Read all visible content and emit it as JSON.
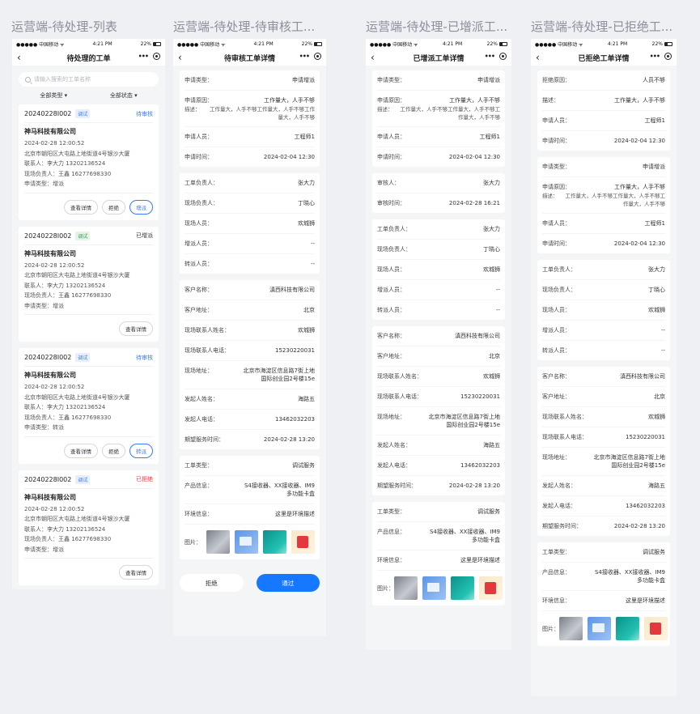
{
  "columns": {
    "list": "运营端-待处理-列表",
    "pending": "运营端-待处理-待审核工...",
    "added": "运营端-待处理-已增派工...",
    "rejected": "运营端-待处理-已拒绝工..."
  },
  "status_bar": {
    "carrier": "●●●●● 中国移动 ᯤ",
    "time": "4:21 PM",
    "battery": "22%"
  },
  "list_screen": {
    "nav_title": "待处理的工单",
    "search_placeholder": "请输入搜索的工单名称",
    "filter_type": "全部类型 ▾",
    "filter_status": "全部状态 ▾",
    "cards": [
      {
        "no": "20240228I002",
        "tag": "调试",
        "tag_color": "blue",
        "status": "待审核",
        "status_color": "#3a7bf0",
        "company": "神马科技有限公司",
        "time": "2024-02-28 12:00:52",
        "addr": "北京市朝阳区大屯路上地街道4号银沙大厦",
        "contact": "联系人：李大力  13202136524",
        "leader": "现场负责人：王鑫  16277698330",
        "apply": "申请类型：增派",
        "actions": [
          "查看详情",
          "拒绝",
          "增派"
        ]
      },
      {
        "no": "20240228I002",
        "tag": "调试",
        "tag_color": "green",
        "status": "已增派",
        "status_color": "#333333",
        "company": "神马科技有限公司",
        "time": "2024-02-28 12:00:52",
        "addr": "北京市朝阳区大屯路上地街道4号银沙大厦",
        "contact": "联系人：李大力  13202136524",
        "leader": "现场负责人：王鑫  16277698330",
        "apply": "申请类型：增派",
        "actions": [
          "查看详情"
        ]
      },
      {
        "no": "20240228I002",
        "tag": "调试",
        "tag_color": "blue",
        "status": "待审核",
        "status_color": "#3a7bf0",
        "company": "神马科技有限公司",
        "time": "2024-02-28 12:00:52",
        "addr": "北京市朝阳区大屯路上地街道4号银沙大厦",
        "contact": "联系人：李大力  13202136524",
        "leader": "现场负责人：王鑫  16277698330",
        "apply": "申请类型：转派",
        "actions": [
          "查看详情",
          "拒绝",
          "转派"
        ]
      },
      {
        "no": "20240228I002",
        "tag": "调试",
        "tag_color": "blue",
        "status": "已拒绝",
        "status_color": "#e4393c",
        "company": "神马科技有限公司",
        "time": "2024-02-28 12:00:52",
        "addr": "北京市朝阳区大屯路上地街道4号银沙大厦",
        "contact": "联系人：李大力  13202136524",
        "leader": "现场负责人：王鑫  16277698330",
        "apply": "申请类型：增派",
        "actions": [
          "查看详情"
        ]
      }
    ]
  },
  "pending_screen": {
    "nav_title": "待审核工单详情",
    "apply": {
      "type_k": "申请类型：",
      "type_v": "申请增派",
      "reason_k": "申请原因：",
      "reason_v": "工作量大，人手不够",
      "desc_k": "描述：",
      "desc_v": "工作量大，人手不够工作量大，人手不够工作量大，人手不够",
      "applicant_k": "申请人员：",
      "applicant_v": "工程师1",
      "time_k": "申请时间：",
      "time_v": "2024-02-04 12:30"
    },
    "staff": [
      [
        "工单负责人：",
        "张大力"
      ],
      [
        "现场负责人：",
        "丁晓心"
      ],
      [
        "现场人员：",
        "欢城狮"
      ],
      [
        "增派人员：",
        "--"
      ],
      [
        "转派人员：",
        "--"
      ]
    ],
    "customer": [
      [
        "客户名称：",
        "滇西科技有限公司"
      ],
      [
        "客户地址：",
        "北京"
      ],
      [
        "现场联系人姓名：",
        "欢城狮"
      ],
      [
        "现场联系人电话：",
        "15230220031"
      ],
      [
        "现场地址：",
        "北京市海淀区信息路7街上地国际创业园2号楼15e"
      ],
      [
        "发起人姓名：",
        "海路五"
      ],
      [
        "发起人电话：",
        "13462032203"
      ],
      [
        "期望服务时间：",
        "2024-02-28 13:20"
      ]
    ],
    "order": [
      [
        "工单类型：",
        "调试服务"
      ],
      [
        "产品信息：",
        "S4接收器、XX接收器、IM9多功能卡盒"
      ],
      [
        "环境信息：",
        "这里是环境描述"
      ]
    ],
    "images_k": "图片：",
    "reject_btn": "拒绝",
    "pass_btn": "通过"
  },
  "added_screen": {
    "nav_title": "已增派工单详情",
    "apply": {
      "type_k": "申请类型：",
      "type_v": "申请增派",
      "reason_k": "申请原因：",
      "reason_v": "工作量大，人手不够",
      "desc_k": "描述：",
      "desc_v": "工作量大，人手不够工作量大，人手不够工作量大，人手不够",
      "applicant_k": "申请人员：",
      "applicant_v": "工程师1",
      "time_k": "申请时间：",
      "time_v": "2024-02-04 12:30"
    },
    "review": [
      [
        "审核人：",
        "张大力"
      ],
      [
        "审核时间：",
        "2024-02-28 16:21"
      ]
    ],
    "staff": [
      [
        "工单负责人：",
        "张大力"
      ],
      [
        "现场负责人：",
        "丁晓心"
      ],
      [
        "现场人员：",
        "欢城狮"
      ],
      [
        "增派人员：",
        "--"
      ],
      [
        "转派人员：",
        "--"
      ]
    ],
    "customer": [
      [
        "客户名称：",
        "滇西科技有限公司"
      ],
      [
        "客户地址：",
        "北京"
      ],
      [
        "现场联系人姓名：",
        "欢城狮"
      ],
      [
        "现场联系人电话：",
        "15230220031"
      ],
      [
        "现场地址：",
        "北京市海淀区信息路7街上地国际创业园2号楼15e"
      ],
      [
        "发起人姓名：",
        "海路五"
      ],
      [
        "发起人电话：",
        "13462032203"
      ],
      [
        "期望服务时间：",
        "2024-02-28 13:20"
      ]
    ],
    "order": [
      [
        "工单类型：",
        "调试服务"
      ],
      [
        "产品信息：",
        "S4接收器、XX接收器、IM9多功能卡盒"
      ],
      [
        "环境信息：",
        "这里是环境描述"
      ]
    ],
    "images_k": "图片："
  },
  "rejected_screen": {
    "nav_title": "已拒绝工单详情",
    "reject": [
      [
        "拒绝原因：",
        "人员不够"
      ],
      [
        "描述：",
        "工作量大，人手不够"
      ],
      [
        "申请人员：",
        "工程师1"
      ],
      [
        "申请时间：",
        "2024-02-04 12:30"
      ]
    ],
    "apply": {
      "type_k": "申请类型：",
      "type_v": "申请增派",
      "reason_k": "申请原因：",
      "reason_v": "工作量大，人手不够",
      "desc_k": "描述：",
      "desc_v": "工作量大，人手不够工作量大，人手不够工作量大，人手不够",
      "applicant_k": "申请人员：",
      "applicant_v": "工程师1",
      "time_k": "申请时间：",
      "time_v": "2024-02-04 12:30"
    },
    "staff": [
      [
        "工单负责人：",
        "张大力"
      ],
      [
        "现场负责人：",
        "丁晓心"
      ],
      [
        "现场人员：",
        "欢城狮"
      ],
      [
        "增派人员：",
        "--"
      ],
      [
        "转派人员：",
        "--"
      ]
    ],
    "customer": [
      [
        "客户名称：",
        "滇西科技有限公司"
      ],
      [
        "客户地址：",
        "北京"
      ],
      [
        "现场联系人姓名：",
        "欢城狮"
      ],
      [
        "现场联系人电话：",
        "15230220031"
      ],
      [
        "现场地址：",
        "北京市海淀区信息路7街上地国际创业园2号楼15e"
      ],
      [
        "发起人姓名：",
        "海路五"
      ],
      [
        "发起人电话：",
        "13462032203"
      ],
      [
        "期望服务时间：",
        "2024-02-28 13:20"
      ]
    ],
    "order": [
      [
        "工单类型：",
        "调试服务"
      ],
      [
        "产品信息：",
        "S4接收器、XX接收器、IM9多功能卡盒"
      ],
      [
        "环境信息：",
        "这里是环境描述"
      ]
    ],
    "images_k": "图片："
  },
  "icons": {
    "back": "chevron-left-icon",
    "more": "more-dots-icon",
    "record": "record-icon",
    "search": "search-icon"
  },
  "colors": {
    "primary": "#1677ff",
    "pending": "#3a7bf0",
    "rejected": "#e4393c",
    "tag_green": "#30a14e"
  }
}
